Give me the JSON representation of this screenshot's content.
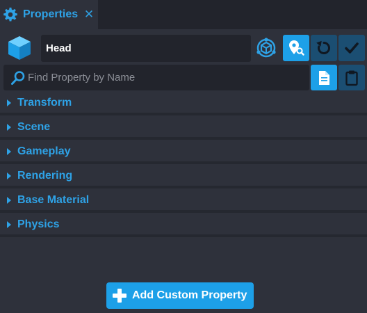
{
  "tab": {
    "title": "Properties",
    "close": "✕",
    "icon": "gear-icon"
  },
  "object": {
    "name": "Head",
    "icon": "cube-icon"
  },
  "toolbar": {
    "network_icon": "network-context-icon",
    "locate_icon": "locate-object-icon",
    "reset_icon": "reset-icon",
    "apply_icon": "checkmark-icon"
  },
  "search": {
    "placeholder": "Find Property by Name",
    "value": ""
  },
  "clipboard": {
    "copy_icon": "copy-icon",
    "paste_icon": "paste-icon"
  },
  "sections": [
    {
      "label": "Transform"
    },
    {
      "label": "Scene"
    },
    {
      "label": "Gameplay"
    },
    {
      "label": "Rendering"
    },
    {
      "label": "Base Material"
    },
    {
      "label": "Physics"
    }
  ],
  "add_custom": {
    "label": "Add Custom Property"
  },
  "colors": {
    "accent": "#1da0e8",
    "accent_text": "#2ea2e6",
    "panel_bg": "#2e313b",
    "field_bg": "#22242c",
    "muted_button": "#1b4e72"
  }
}
